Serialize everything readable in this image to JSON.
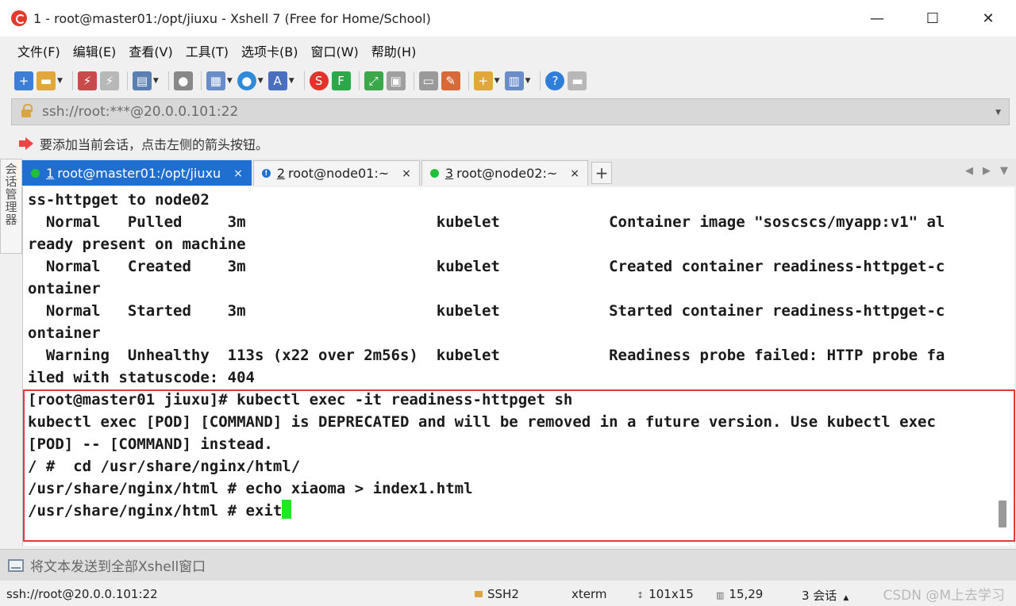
{
  "window": {
    "title": "1 - root@master01:/opt/jiuxu - Xshell 7 (Free for Home/School)",
    "minimize": "—",
    "maximize": "☐",
    "close": "✕"
  },
  "menu": [
    "文件(F)",
    "编辑(E)",
    "查看(V)",
    "工具(T)",
    "选项卡(B)",
    "窗口(W)",
    "帮助(H)"
  ],
  "address": {
    "text": "ssh://root:***@20.0.0.101:22"
  },
  "hint": {
    "text": "要添加当前会话，点击左侧的箭头按钮。"
  },
  "side_tab": {
    "label": "会话管理器"
  },
  "tabs": [
    {
      "num": "1",
      "label": "root@master01:/opt/jiuxu",
      "active": true
    },
    {
      "num": "2",
      "label": "root@node01:~",
      "active": false
    },
    {
      "num": "3",
      "label": "root@node02:~",
      "active": false
    }
  ],
  "tab_close": "×",
  "tab_add": "+",
  "terminal": {
    "lines": [
      "ss-httpget to node02",
      "  Normal   Pulled     3m                     kubelet            Container image \"soscscs/myapp:v1\" al",
      "ready present on machine",
      "  Normal   Created    3m                     kubelet            Created container readiness-httpget-c",
      "ontainer",
      "  Normal   Started    3m                     kubelet            Started container readiness-httpget-c",
      "ontainer",
      "  Warning  Unhealthy  113s (x22 over 2m56s)  kubelet            Readiness probe failed: HTTP probe fa",
      "iled with statuscode: 404",
      "[root@master01 jiuxu]# kubectl exec -it readiness-httpget sh",
      "kubectl exec [POD] [COMMAND] is DEPRECATED and will be removed in a future version. Use kubectl exec",
      "[POD] -- [COMMAND] instead.",
      "/ #  cd /usr/share/nginx/html/",
      "/usr/share/nginx/html # echo xiaoma > index1.html",
      "/usr/share/nginx/html # exit"
    ]
  },
  "send_bar": {
    "text": "将文本发送到全部Xshell窗口"
  },
  "status": {
    "connection": "ssh://root@20.0.0.101:22",
    "protocol": "SSH2",
    "terminal_type": "xterm",
    "size": "101x15",
    "cursor_pos": "15,29",
    "sessions": "3 会话",
    "watermark": "CSDN @M上去学习"
  },
  "colors": {
    "active_tab": "#1f6fd1",
    "cursor": "#1ee81e",
    "highlight": "#e03a3a"
  }
}
